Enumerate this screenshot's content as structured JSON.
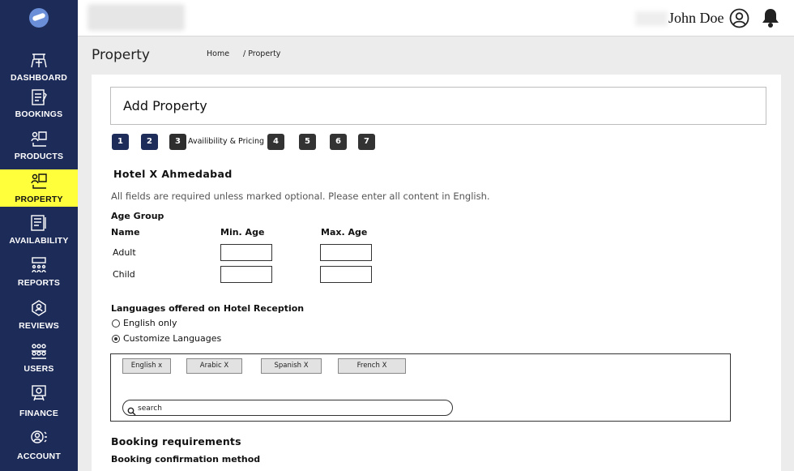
{
  "sidebar": {
    "items": [
      {
        "label": "DASHBOARD",
        "icon": "dashboard-icon",
        "active": false
      },
      {
        "label": "BOOKINGS",
        "icon": "bookings-icon",
        "active": false
      },
      {
        "label": "PRODUCTS",
        "icon": "products-icon",
        "active": false
      },
      {
        "label": "PROPERTY",
        "icon": "property-icon",
        "active": true
      },
      {
        "label": "AVAILABILITY",
        "icon": "availability-icon",
        "active": false
      },
      {
        "label": "REPORTS",
        "icon": "reports-icon",
        "active": false
      },
      {
        "label": "REVIEWS",
        "icon": "reviews-icon",
        "active": false
      },
      {
        "label": "USERS",
        "icon": "users-icon",
        "active": false
      },
      {
        "label": "FINANCE",
        "icon": "finance-icon",
        "active": false
      },
      {
        "label": "ACCOUNT",
        "icon": "account-icon",
        "active": false
      }
    ]
  },
  "topbar": {
    "username": "John Doe"
  },
  "header": {
    "title": "Property",
    "breadcrumb": {
      "home": "Home",
      "current": "/ Property"
    }
  },
  "main": {
    "form_title": "Add Property",
    "steps": [
      {
        "number": "1",
        "status": "done"
      },
      {
        "number": "2",
        "status": "done"
      },
      {
        "number": "3",
        "status": "current",
        "label": "Availibility & Pricing"
      },
      {
        "number": "4",
        "status": "todo"
      },
      {
        "number": "5",
        "status": "todo"
      },
      {
        "number": "6",
        "status": "todo"
      },
      {
        "number": "7",
        "status": "todo"
      }
    ],
    "hotel_name": "Hotel X Ahmedabad",
    "note": "All fields are required unless marked optional. Please enter all content in English.",
    "age_group": {
      "title": "Age Group",
      "col_name": "Name",
      "col_min": "Min. Age",
      "col_max": "Max. Age",
      "rows": [
        {
          "name": "Adult",
          "min": "",
          "max": ""
        },
        {
          "name": "Child",
          "min": "",
          "max": ""
        }
      ]
    },
    "languages": {
      "title": "Languages offered on Hotel Reception",
      "option_english_only": "English only",
      "option_customize": "Customize Languages",
      "selected": "Customize Languages",
      "chips": [
        "English x",
        "Arabic X",
        "Spanish X",
        "French X"
      ],
      "search_placeholder": "search"
    },
    "booking": {
      "title": "Booking requirements",
      "subtitle": "Booking confirmation method"
    }
  },
  "colors": {
    "sidebar_bg": "#1d2b58",
    "sidebar_active": "#ffff3c",
    "step_done": "#1e2c59"
  }
}
